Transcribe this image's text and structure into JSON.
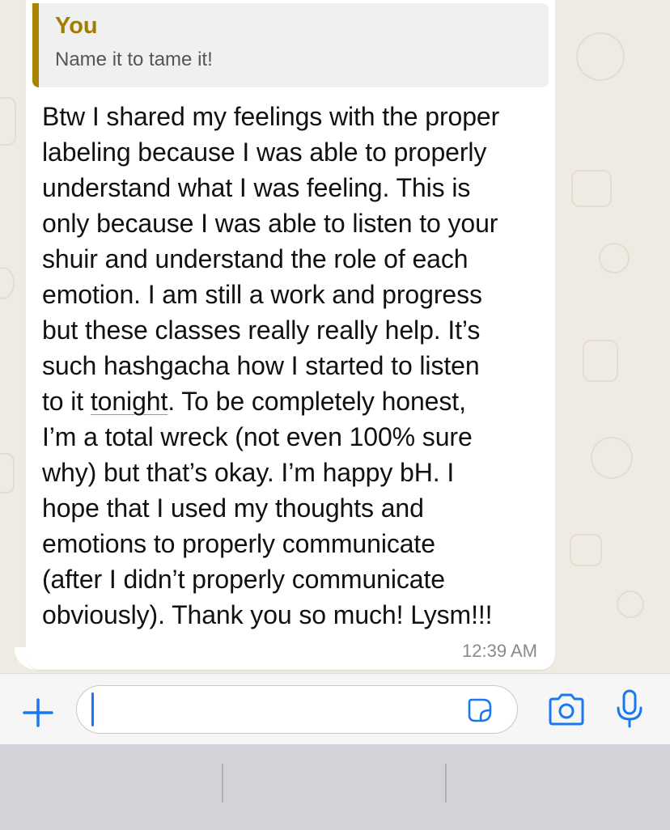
{
  "quote": {
    "author": "You",
    "text": "Name it to tame it!"
  },
  "message": {
    "lines": [
      "Btw I shared my feelings with the proper",
      "labeling because I was able to properly",
      "understand what I was feeling. This is",
      "only because I was able to listen to your",
      "shuir and understand the role of each",
      "emotion. I am still a work and progress",
      "but these classes really really help. It’s",
      "such hashgacha how I started to listen",
      "to it ",
      "tonight",
      ". To be completely honest,",
      "I’m a total wreck (not even 100% sure",
      "why) but that’s okay. I’m happy bH. I",
      "hope that I used my thoughts and",
      "emotions to properly communicate",
      "(after I didn’t properly communicate",
      "obviously). Thank you so much! Lysm!!!"
    ],
    "timestamp": "12:39 AM"
  },
  "input_bar": {
    "icons": [
      "plus-icon",
      "sticker-icon",
      "camera-icon",
      "microphone-icon"
    ],
    "placeholder": ""
  },
  "colors": {
    "accent": "#1877f2",
    "quote_bar": "#a88400",
    "quote_author": "#a27d05",
    "wallpaper": "#efeae2"
  }
}
